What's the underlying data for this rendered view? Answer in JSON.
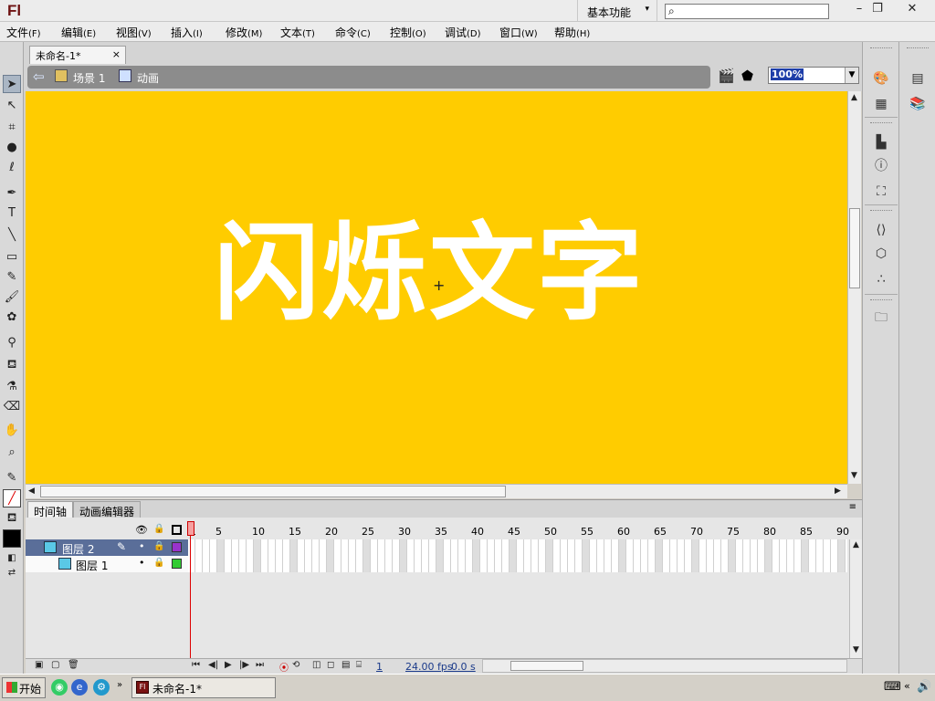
{
  "app": {
    "logo": "Fl"
  },
  "titlebar": {
    "workspace": "基本功能",
    "search_placeholder": "",
    "minimize": "–",
    "restore": "❐",
    "close": "✕"
  },
  "menu": [
    {
      "label": "文件",
      "key": "(F)"
    },
    {
      "label": "编辑",
      "key": "(E)"
    },
    {
      "label": "视图",
      "key": "(V)"
    },
    {
      "label": "插入",
      "key": "(I)"
    },
    {
      "label": "修改",
      "key": "(M)"
    },
    {
      "label": "文本",
      "key": "(T)"
    },
    {
      "label": "命令",
      "key": "(C)"
    },
    {
      "label": "控制",
      "key": "(O)"
    },
    {
      "label": "调试",
      "key": "(D)"
    },
    {
      "label": "窗口",
      "key": "(W)"
    },
    {
      "label": "帮助",
      "key": "(H)"
    }
  ],
  "document": {
    "tab_title": "未命名-1*",
    "tab_close": "×"
  },
  "editbar": {
    "scene": "场景 1",
    "symbol": "动画",
    "zoom": "100%"
  },
  "stage": {
    "background": "#ffcc00",
    "text": "闪烁文字",
    "text_color": "#ffffff"
  },
  "timeline": {
    "tab_timeline": "时间轴",
    "tab_motion_editor": "动画编辑器",
    "frame_numbers": [
      "1",
      "5",
      "10",
      "15",
      "20",
      "25",
      "30",
      "35",
      "40",
      "45",
      "50",
      "55",
      "60",
      "65",
      "70",
      "75",
      "80",
      "85",
      "90"
    ],
    "layers": [
      {
        "name": "图层 2",
        "selected": true,
        "color": "#9933cc"
      },
      {
        "name": "图层 1",
        "selected": false,
        "color": "#33cc33"
      }
    ],
    "current_frame": "1",
    "fps": "24.00 fps",
    "time": "0.0 s"
  },
  "taskbar": {
    "start": "开始",
    "task": "未命名-1*"
  }
}
